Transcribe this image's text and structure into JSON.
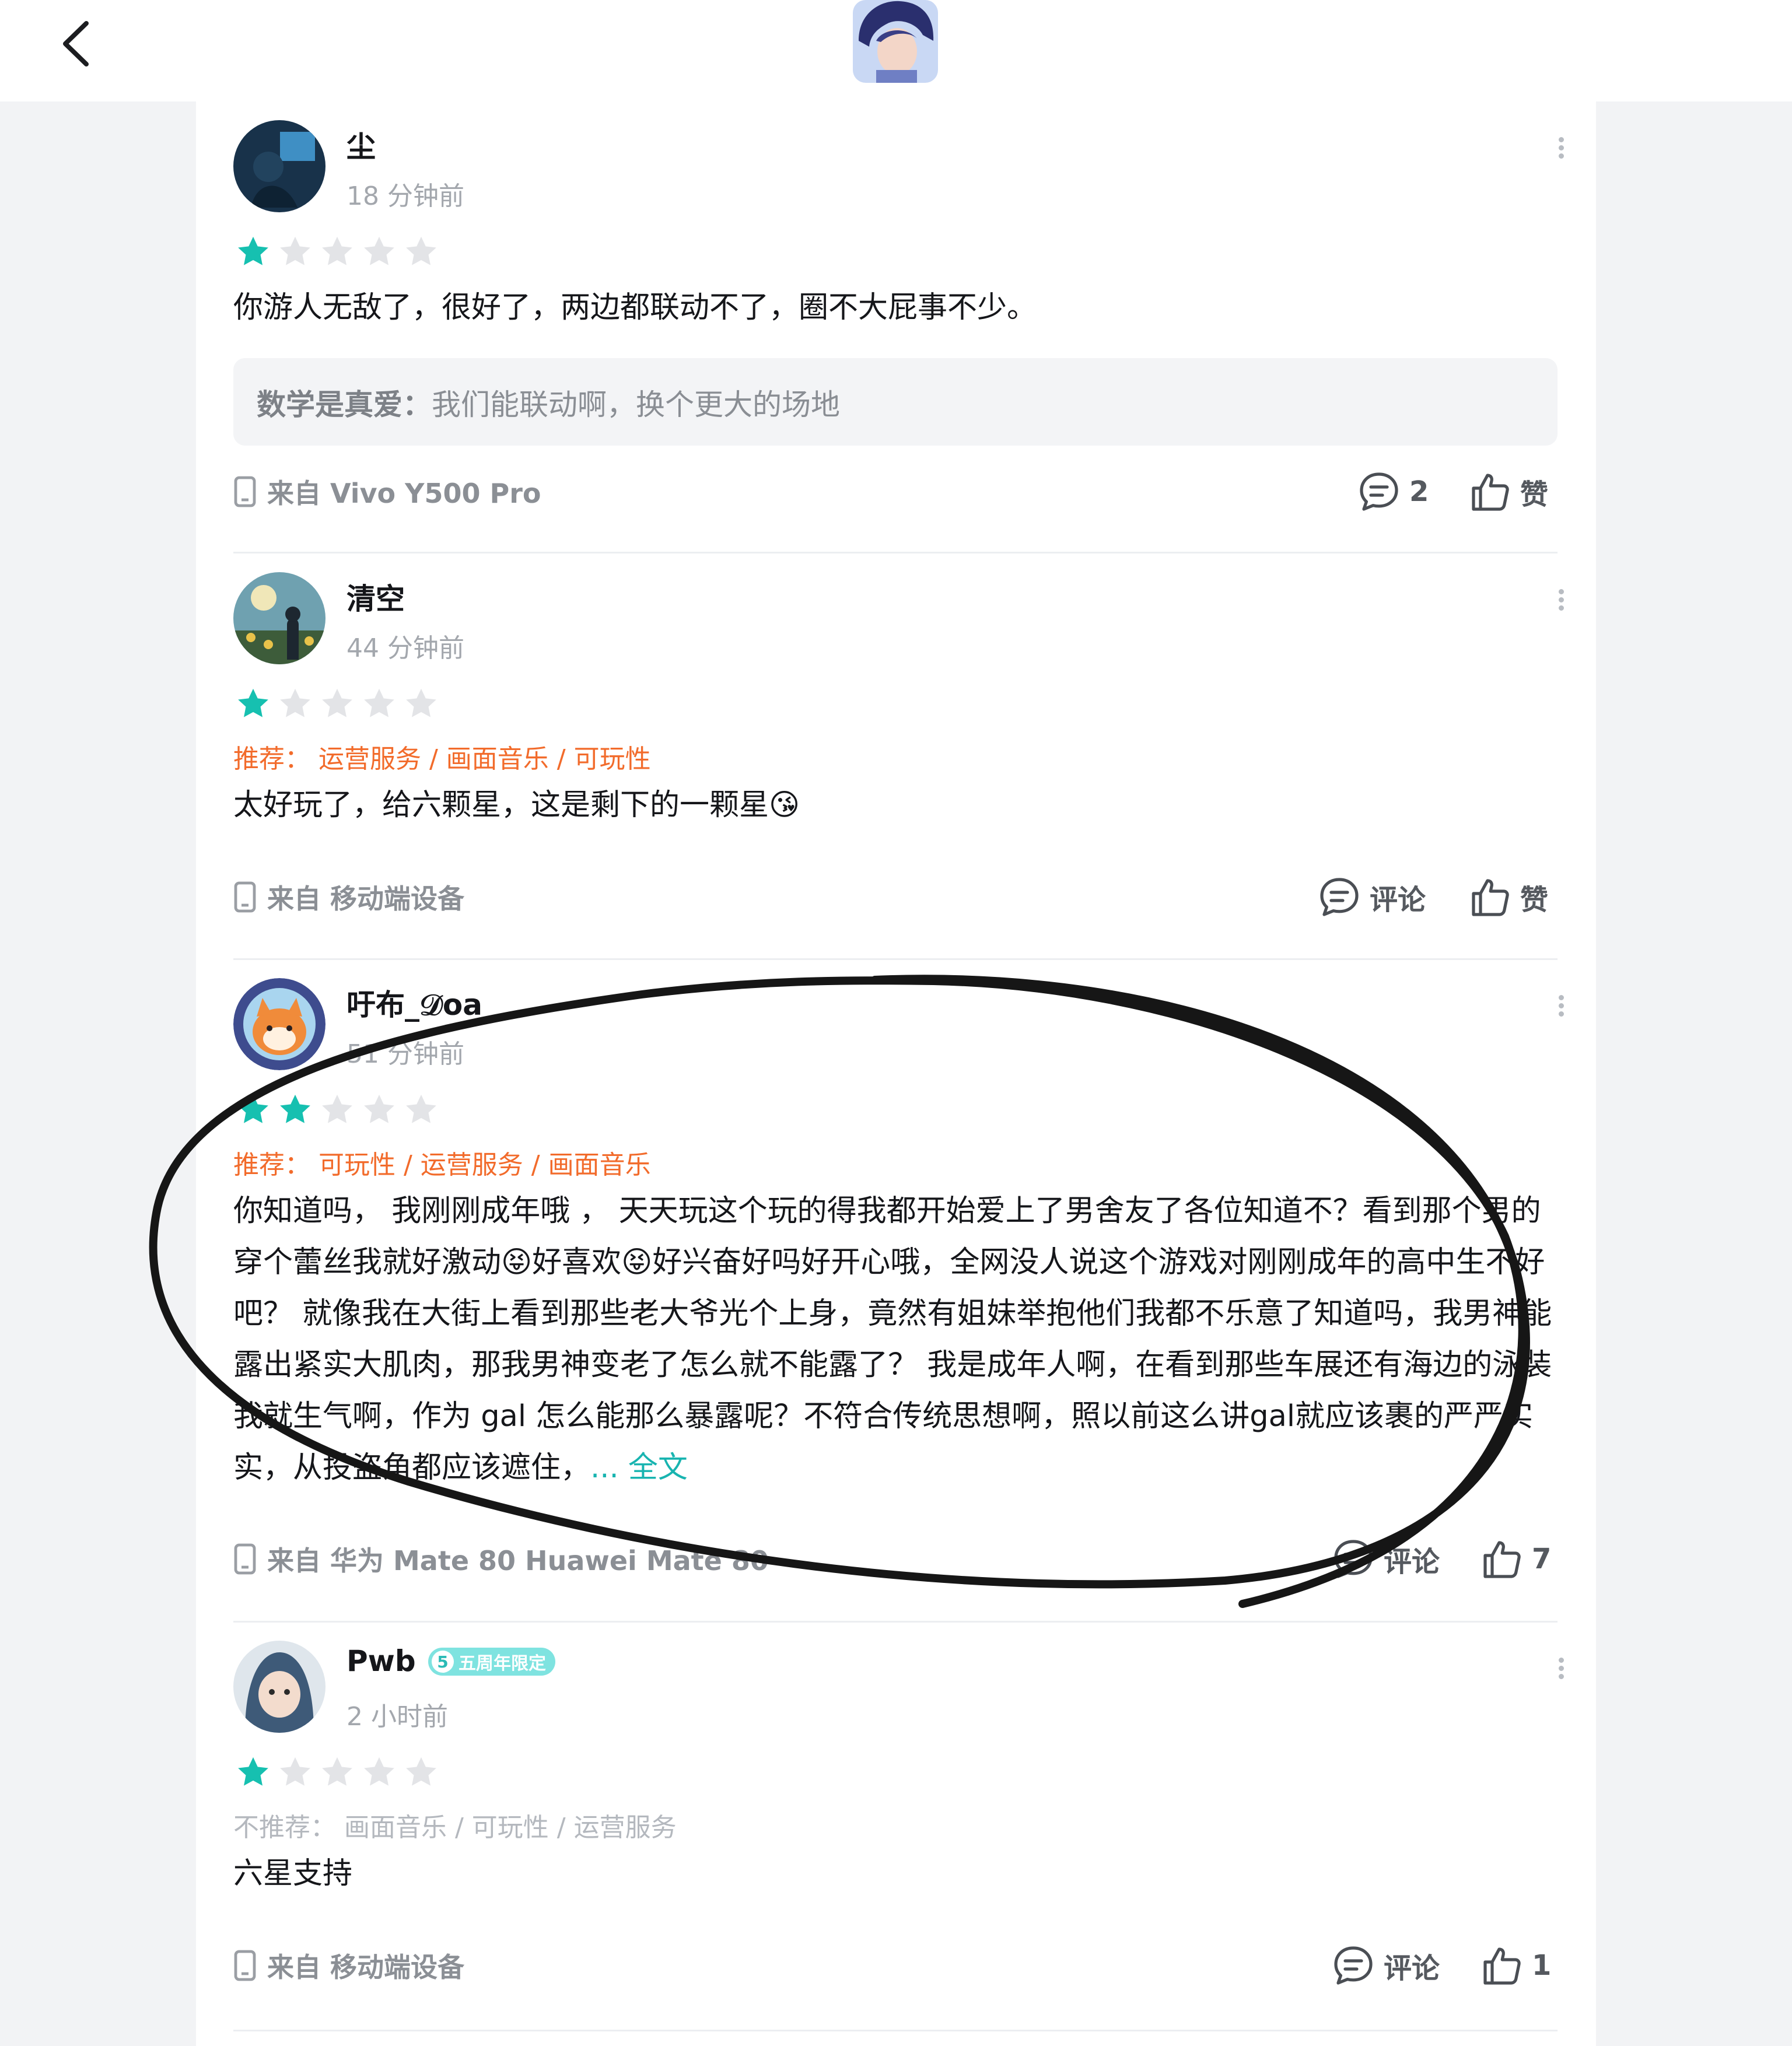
{
  "header": {
    "back_icon": "chevron-left-icon",
    "avatar_icon": "user-avatar"
  },
  "colors": {
    "star_active": "#16c0b0",
    "star_inactive": "#e3e4e7",
    "recommend": "#f26b2b",
    "not_recommend": "#b4b8be",
    "link": "#18b4b0"
  },
  "reviews": [
    {
      "username": "尘",
      "time": "18 分钟前",
      "rating": 1,
      "text": "你游人无敌了，很好了，两边都联动不了，圈不大屁事不少。",
      "reply": {
        "name": "数学是真爱：",
        "text": "我们能联动啊，换个更大的场地"
      },
      "device": "来自 Vivo Y500 Pro",
      "comment": "2",
      "like": "赞"
    },
    {
      "username": "清空",
      "time": "44 分钟前",
      "rating": 1,
      "recommend": "推荐：  运营服务 / 画面音乐 / 可玩性",
      "text": "太好玩了，给六颗星，这是剩下的一颗星😘",
      "device": "来自 移动端设备",
      "comment": "评论",
      "like": "赞"
    },
    {
      "username": "吁布_𝒟oa",
      "time": "51 分钟前",
      "rating": 2,
      "recommend": "推荐：  可玩性 / 运营服务 / 画面音乐",
      "text": "你知道吗， 我刚刚成年哦 ， 天天玩这个玩的得我都开始爱上了男舍友了各位知道不？看到那个男的穿个蕾丝我就好激动😝好喜欢😝好兴奋好吗好开心哦，全网没人说这个游戏对刚刚成年的高中生不好吧？ 就像我在大街上看到那些老大爷光个上身，竟然有姐妹举抱他们我都不乐意了知道吗，我男神能露出紧实大肌肉，那我男神变老了怎么就不能露了？ 我是成年人啊，在看到那些车展还有海边的泳装我就生气啊，作为 gal 怎么能那么暴露呢？不符合传统思想啊，照以前这么讲gal就应该裹的严严实实，从投盗角都应该遮住，",
      "more": "... 全文",
      "device": "来自 华为 Mate 80 Huawei Mate 80",
      "comment": "评论",
      "like": "7"
    },
    {
      "username": "Pwb",
      "badge": "五周年限定",
      "badge_coin": "5",
      "time": "2 小时前",
      "rating": 1,
      "recommend": "不推荐：  画面音乐 / 可玩性 / 运营服务",
      "text": "六星支持",
      "device": "来自 移动端设备",
      "comment": "评论",
      "like": "1"
    }
  ]
}
